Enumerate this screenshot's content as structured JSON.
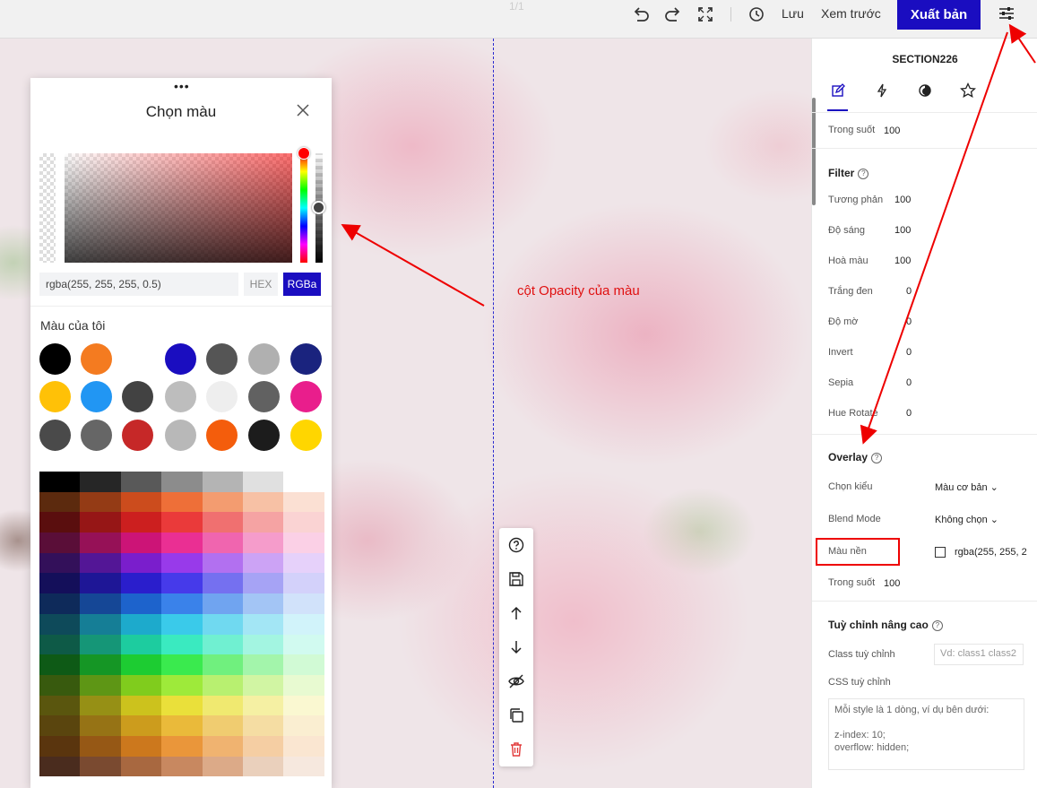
{
  "topbar": {
    "pager": "1/1",
    "save_label": "Lưu",
    "preview_label": "Xem trước",
    "publish_label": "Xuất bản",
    "accent_color": "#1a0dc0"
  },
  "canvas": {
    "annotation": "cột Opacity của màu"
  },
  "color_picker": {
    "title": "Chọn màu",
    "color_value": "rgba(255, 255, 255, 0.5)",
    "mode_hex": "HEX",
    "mode_rgba": "RGBa",
    "active_mode": "RGBa",
    "hue_color": "#ff0000",
    "opacity": 0.5,
    "my_colors_label": "Màu của tôi",
    "my_colors": [
      [
        "#000000",
        "#f47b20",
        null,
        "#1a0dc0",
        "#555555",
        "#b0b0b0",
        "#1a237e"
      ],
      [
        "#ffc107",
        "#2196f3",
        "#424242",
        "#bdbdbd",
        "#eeeeee",
        "#616161",
        "#e91e8c"
      ],
      [
        "#4a4a4a",
        "#666666",
        "#c62828",
        "#b8b8b8",
        "#f45d0c",
        "#1c1c1c",
        "#ffd600"
      ]
    ],
    "palette": [
      [
        "#000000",
        "#262626",
        "#595959",
        "#8c8c8c",
        "#b4b4b4",
        "#e0e0e0",
        "#ffffff"
      ],
      [
        "#5c2a0e",
        "#943b15",
        "#cc4c1d",
        "#ee6f38",
        "#f39c70",
        "#f7c1a5",
        "#fbe0d3"
      ],
      [
        "#5a0e0e",
        "#961616",
        "#cc1f1f",
        "#ea3a3a",
        "#f07070",
        "#f5a3a3",
        "#fad3d3"
      ],
      [
        "#5a0e38",
        "#961157",
        "#cc1477",
        "#ea2f93",
        "#f065af",
        "#f59ccb",
        "#fbd0e6"
      ],
      [
        "#33105a",
        "#531696",
        "#7a1ecc",
        "#983aea",
        "#b270f0",
        "#cca3f5",
        "#e6d1fa"
      ],
      [
        "#140f5a",
        "#1e1696",
        "#2a1ecc",
        "#463aea",
        "#7570f0",
        "#a6a3f5",
        "#d3d1fa"
      ],
      [
        "#0e2a5a",
        "#154796",
        "#1d63cc",
        "#3a82ea",
        "#70a4f0",
        "#a3c5f5",
        "#d1e2fa"
      ],
      [
        "#0e4a5a",
        "#157e96",
        "#1daacc",
        "#3acaea",
        "#70d9f0",
        "#a3e6f5",
        "#d1f3fa"
      ],
      [
        "#0e5a47",
        "#159677",
        "#1dcc9f",
        "#3aeac0",
        "#70f0d1",
        "#a3f5e1",
        "#d1faf0"
      ],
      [
        "#0e5a16",
        "#159625",
        "#1dcc32",
        "#3aea4e",
        "#70f07e",
        "#a3f5ab",
        "#d1fad5"
      ],
      [
        "#385a0e",
        "#5e9615",
        "#80cc1d",
        "#9eea3a",
        "#b8f070",
        "#d1f5a3",
        "#e8fad1"
      ],
      [
        "#5a560e",
        "#969015",
        "#ccc21d",
        "#eae03a",
        "#f0e970",
        "#f5f0a3",
        "#faf8d1"
      ],
      [
        "#5a450e",
        "#967315",
        "#cc9c1d",
        "#eaba3a",
        "#f0cc70",
        "#f5dda3",
        "#faeed1"
      ],
      [
        "#5a350e",
        "#965815",
        "#cc781d",
        "#ea963a",
        "#f0b370",
        "#f5cea3",
        "#fae6d1"
      ],
      [
        "#4a2c1e",
        "#7a4a30",
        "#a86840",
        "#c88860",
        "#dcaa88",
        "#ead0bc",
        "#f6e8de"
      ]
    ]
  },
  "right_panel": {
    "section_title": "SECTION226",
    "tabs": [
      "edit",
      "action",
      "effects",
      "favorite"
    ],
    "opacity_top": {
      "label": "Trong suốt",
      "value": "100"
    },
    "filter": {
      "title": "Filter",
      "items": [
        {
          "label": "Tương phản",
          "value": "100"
        },
        {
          "label": "Độ sáng",
          "value": "100"
        },
        {
          "label": "Hoà màu",
          "value": "100"
        },
        {
          "label": "Trắng đen",
          "value": "0"
        },
        {
          "label": "Độ mờ",
          "value": "0"
        },
        {
          "label": "Invert",
          "value": "0"
        },
        {
          "label": "Sepia",
          "value": "0"
        },
        {
          "label": "Hue Rotate",
          "value": "0"
        }
      ]
    },
    "overlay": {
      "title": "Overlay",
      "type_label": "Chọn kiểu",
      "type_value": "Màu cơ bản",
      "blend_label": "Blend Mode",
      "blend_value": "Không chọn",
      "bg_label": "Màu nền",
      "bg_value": "rgba(255, 255, 2",
      "opacity_label": "Trong suốt",
      "opacity_value": "100"
    },
    "advanced": {
      "title": "Tuỳ chỉnh nâng cao",
      "class_label": "Class tuỳ chỉnh",
      "class_placeholder": "Vd: class1 class2",
      "css_label": "CSS tuỳ chỉnh",
      "css_placeholder": "Mỗi style là 1 dòng, ví dụ bên dưới:\n\nz-index: 10;\noverflow: hidden;"
    }
  }
}
